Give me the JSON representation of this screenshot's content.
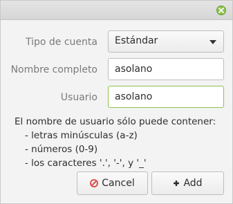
{
  "dialog": {
    "close_icon": "close-icon",
    "accent_color": "#8bc34a"
  },
  "form": {
    "account_type_label": "Tipo de cuenta",
    "account_type_value": "Estándar",
    "full_name_label": "Nombre completo",
    "full_name_value": "asolano",
    "username_label": "Usuario",
    "username_value": "asolano"
  },
  "help": {
    "intro": "El nombre de usuario sólo puede contener:",
    "items": [
      "- letras minúsculas (a-z)",
      "- números (0-9)",
      "- los caracteres '.', '-', y '_'"
    ]
  },
  "buttons": {
    "cancel_label": "Cancel",
    "cancel_icon": "cancel-icon",
    "add_label": "Add",
    "add_icon": "plus-icon",
    "cancel_icon_color": "#d9534f"
  }
}
